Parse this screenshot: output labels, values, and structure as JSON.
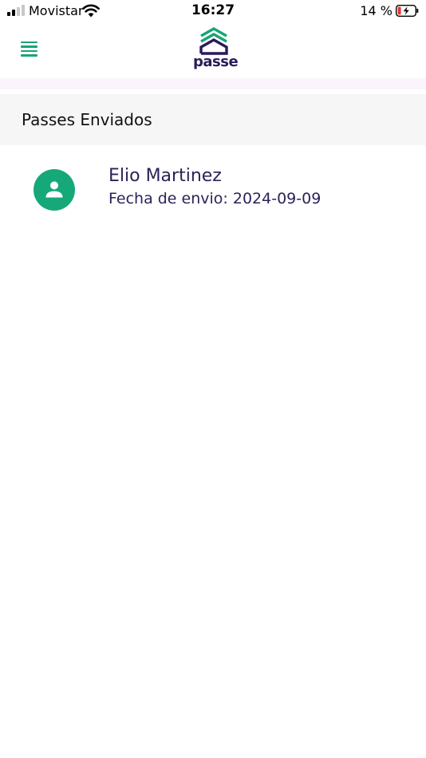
{
  "status_bar": {
    "carrier": "Movistar",
    "time": "16:27",
    "battery_percent": "14 %",
    "icons": [
      "signal-icon",
      "wifi-icon",
      "battery-charging-icon"
    ]
  },
  "header": {
    "menu_icon": "hamburger-menu-icon",
    "logo_text": "passe",
    "colors": {
      "logo_purple": "#2b1a5a",
      "logo_green": "#18a575"
    }
  },
  "section": {
    "title": "Passes Enviados"
  },
  "passes": [
    {
      "name": "Elio Martinez",
      "date_line": "Fecha de envio: 2024-09-09",
      "avatar_icon": "person-icon"
    }
  ],
  "colors": {
    "accent_green": "#16a878",
    "text_navy": "#2a2358",
    "section_bg": "#f6f6f6"
  }
}
